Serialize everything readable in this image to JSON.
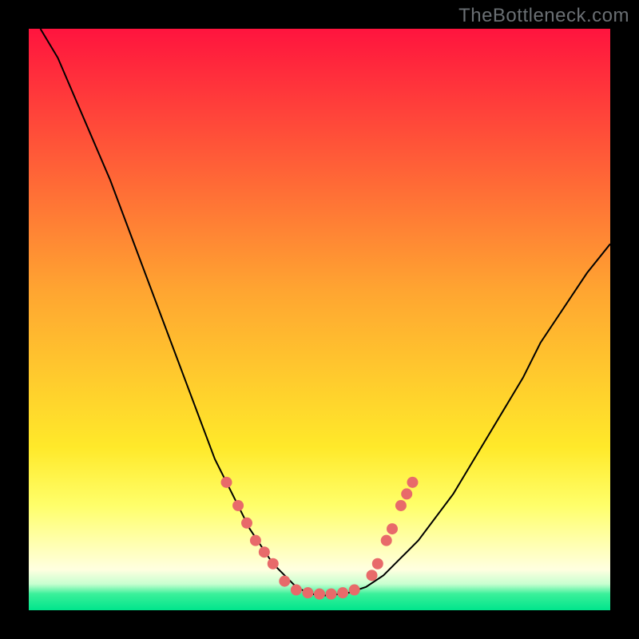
{
  "watermark": "TheBottleneck.com",
  "chart_data": {
    "type": "line",
    "title": "",
    "xlabel": "",
    "ylabel": "",
    "xlim": [
      0,
      100
    ],
    "ylim": [
      0,
      100
    ],
    "grid": false,
    "background_gradient": {
      "stops": [
        {
          "offset": 0.0,
          "color": "#ff143e"
        },
        {
          "offset": 0.45,
          "color": "#ffa531"
        },
        {
          "offset": 0.72,
          "color": "#ffe92a"
        },
        {
          "offset": 0.82,
          "color": "#ffff6a"
        },
        {
          "offset": 0.88,
          "color": "#ffffaa"
        },
        {
          "offset": 0.93,
          "color": "#ffffe0"
        },
        {
          "offset": 0.955,
          "color": "#c7ffd0"
        },
        {
          "offset": 0.972,
          "color": "#3af09a"
        },
        {
          "offset": 1.0,
          "color": "#00e58c"
        }
      ]
    },
    "series": [
      {
        "name": "bottleneck-curve",
        "x": [
          2,
          5,
          8,
          11,
          14,
          17,
          20,
          23,
          26,
          29,
          32,
          34,
          36,
          38,
          40,
          42,
          44,
          46,
          48,
          50,
          52,
          55,
          58,
          61,
          64,
          67,
          70,
          73,
          76,
          79,
          82,
          85,
          88,
          92,
          96,
          100
        ],
        "y": [
          100,
          95,
          88,
          81,
          74,
          66,
          58,
          50,
          42,
          34,
          26,
          22,
          18,
          14,
          11,
          8,
          6,
          4,
          3,
          2.5,
          2.6,
          3,
          4,
          6,
          9,
          12,
          16,
          20,
          25,
          30,
          35,
          40,
          46,
          52,
          58,
          63
        ],
        "stroke": "#000000",
        "stroke_width": 2
      }
    ],
    "markers": {
      "color": "#e86a6a",
      "r": 7,
      "points": [
        {
          "x": 34,
          "y": 22
        },
        {
          "x": 36,
          "y": 18
        },
        {
          "x": 37.5,
          "y": 15
        },
        {
          "x": 39,
          "y": 12
        },
        {
          "x": 40.5,
          "y": 10
        },
        {
          "x": 42,
          "y": 8
        },
        {
          "x": 44,
          "y": 5
        },
        {
          "x": 46,
          "y": 3.5
        },
        {
          "x": 48,
          "y": 3
        },
        {
          "x": 50,
          "y": 2.8
        },
        {
          "x": 52,
          "y": 2.8
        },
        {
          "x": 54,
          "y": 3
        },
        {
          "x": 56,
          "y": 3.5
        },
        {
          "x": 59,
          "y": 6
        },
        {
          "x": 60,
          "y": 8
        },
        {
          "x": 61.5,
          "y": 12
        },
        {
          "x": 62.5,
          "y": 14
        },
        {
          "x": 64,
          "y": 18
        },
        {
          "x": 65,
          "y": 20
        },
        {
          "x": 66,
          "y": 22
        }
      ]
    }
  }
}
